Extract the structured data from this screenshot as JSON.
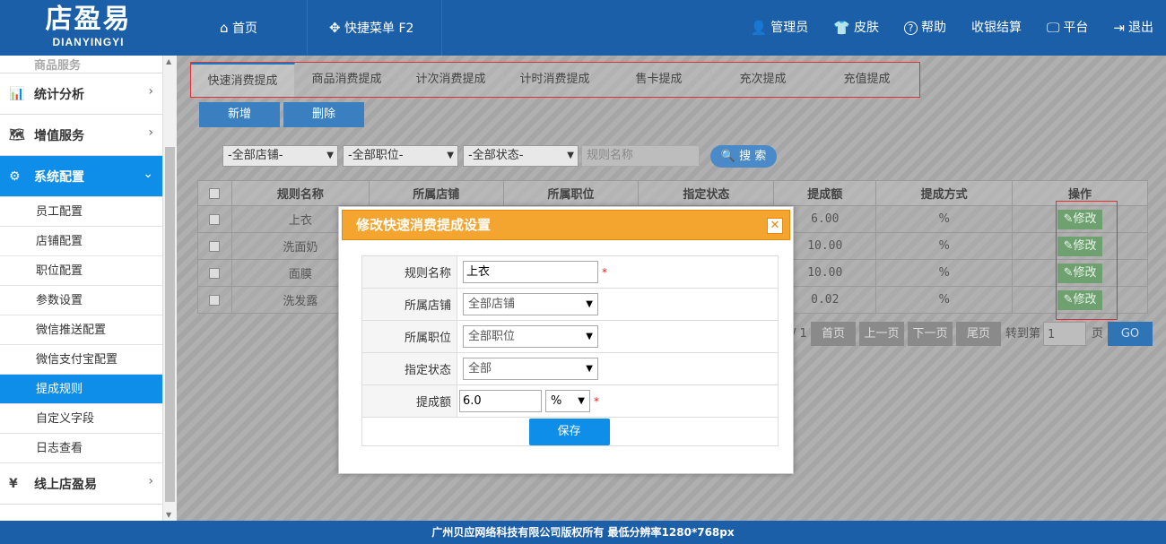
{
  "brand": {
    "cn": "店盈易",
    "en": "DIANYINGYI"
  },
  "header": {
    "nav": [
      {
        "label": "首页",
        "icon": "home-icon",
        "glyph": "⌂"
      },
      {
        "label": "快捷菜单 F2",
        "icon": "move-icon",
        "glyph": "✥"
      }
    ],
    "right": [
      {
        "label": "管理员",
        "icon": "user-icon",
        "glyph": "👤"
      },
      {
        "label": "皮肤",
        "icon": "shirt-icon",
        "glyph": "👕"
      },
      {
        "label": "帮助",
        "icon": "help-icon",
        "glyph": "?"
      },
      {
        "label": "收银结算",
        "icon": "",
        "glyph": ""
      },
      {
        "label": "平台",
        "icon": "monitor-icon",
        "glyph": "🖵"
      },
      {
        "label": "退出",
        "icon": "logout-icon",
        "glyph": "⇥"
      }
    ]
  },
  "sidebar": {
    "partial_label": "商品服务",
    "groups": [
      {
        "label": "统计分析",
        "icon": "chart-icon",
        "glyph": "📊"
      },
      {
        "label": "增值服务",
        "icon": "map-icon",
        "glyph": "🗺"
      },
      {
        "label": "系统配置",
        "icon": "gear-icon",
        "glyph": "⚙"
      }
    ],
    "subitems": [
      "员工配置",
      "店铺配置",
      "职位配置",
      "参数设置",
      "微信推送配置",
      "微信支付宝配置",
      "提成规则",
      "自定义字段",
      "日志查看"
    ],
    "active_sub": "提成规则",
    "bottom_group": {
      "label": "线上店盈易",
      "icon": "cashier-icon",
      "glyph": "¥"
    }
  },
  "tabs": [
    "快速消费提成",
    "商品消费提成",
    "计次消费提成",
    "计时消费提成",
    "售卡提成",
    "充次提成",
    "充值提成"
  ],
  "toolbar": {
    "add": "新增",
    "delete": "删除"
  },
  "filters": {
    "store": "-全部店铺-",
    "position": "-全部职位-",
    "status": "-全部状态-",
    "rule_name_placeholder": "规则名称",
    "search": "搜 索"
  },
  "table": {
    "headers": [
      "规则名称",
      "所属店铺",
      "所属职位",
      "指定状态",
      "提成额",
      "提成方式",
      "操作"
    ],
    "rows": [
      {
        "name": "上衣",
        "amount": "6.00",
        "mode": "%",
        "op": "修改"
      },
      {
        "name": "洗面奶",
        "amount": "10.00",
        "mode": "%",
        "op": "修改"
      },
      {
        "name": "面膜",
        "amount": "10.00",
        "mode": "%",
        "op": "修改"
      },
      {
        "name": "洗发露",
        "amount": "0.02",
        "mode": "%",
        "op": "修改"
      }
    ]
  },
  "pager": {
    "page_info": "/ 1",
    "first": "首页",
    "prev": "上一页",
    "next": "下一页",
    "last": "尾页",
    "goto": "转到第",
    "page_value": "1",
    "page_unit": "页",
    "go": "GO"
  },
  "dialog": {
    "title": "修改快速消费提成设置",
    "fields": {
      "rule_name_label": "规则名称",
      "rule_name_value": "上衣",
      "store_label": "所属店铺",
      "store_value": "全部店铺",
      "position_label": "所属职位",
      "position_value": "全部职位",
      "status_label": "指定状态",
      "status_value": "全部",
      "amount_label": "提成额",
      "amount_value": "6.0",
      "unit_value": "%"
    },
    "required_mark": "*",
    "save": "保存"
  },
  "footer": "广州贝应网络科技有限公司版权所有 最低分辨率1280*768px"
}
